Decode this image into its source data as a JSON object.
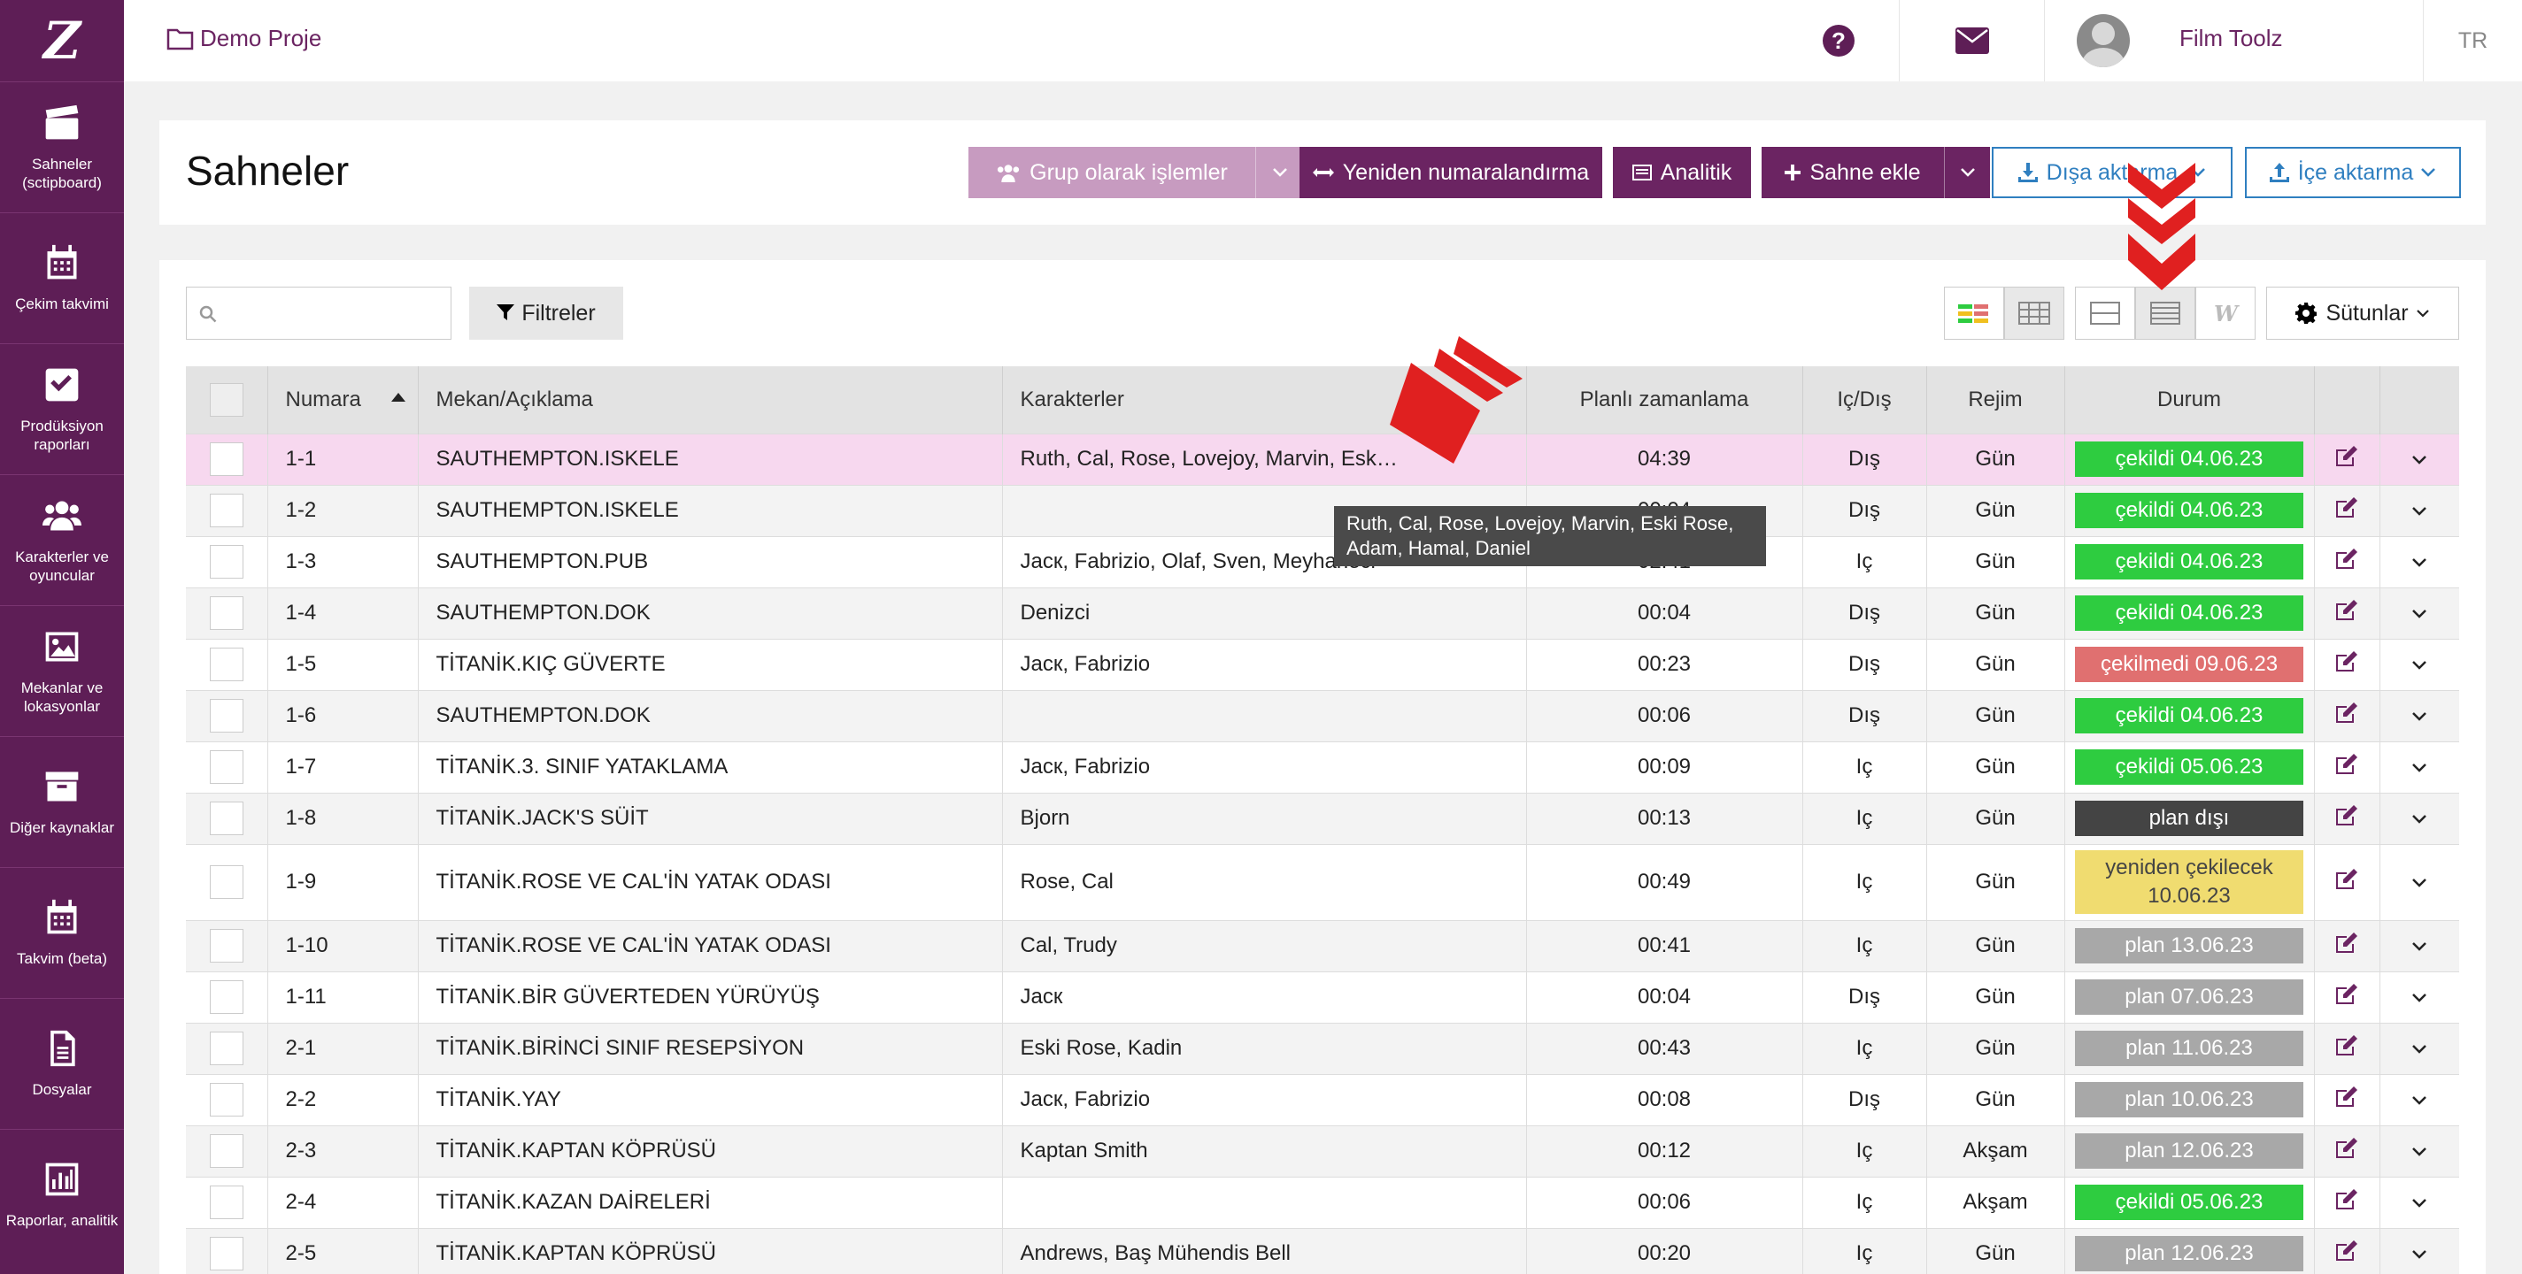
{
  "sidebar": {
    "logo": "Z",
    "items": [
      {
        "label": "Sahneler (sctipboard)",
        "icon": "clapperboard-icon"
      },
      {
        "label": "Çekim takvimi",
        "icon": "calendar-icon"
      },
      {
        "label": "Prodüksiyon raporları",
        "icon": "checkbox-icon"
      },
      {
        "label": "Karakterler ve oyuncular",
        "icon": "users-icon"
      },
      {
        "label": "Mekanlar ve lokasyonlar",
        "icon": "image-icon"
      },
      {
        "label": "Diğer kaynaklar",
        "icon": "archive-icon"
      },
      {
        "label": "Takvim (beta)",
        "icon": "calendar-icon"
      },
      {
        "label": "Dosyalar",
        "icon": "file-icon"
      },
      {
        "label": "Raporlar, analitik",
        "icon": "bar-chart-icon"
      }
    ]
  },
  "topbar": {
    "project": "Demo Proje",
    "username": "Film Toolz",
    "lang": "TR"
  },
  "header": {
    "title": "Sahneler",
    "group_ops": "Grup olarak işlemler",
    "renumber": "Yeniden numaralandırma",
    "analytics": "Analitik",
    "add_scene": "Sahne ekle",
    "export": "Dışa aktarma",
    "import": "İçe aktarma"
  },
  "toolbar": {
    "filters": "Filtreler",
    "columns": "Sütunlar"
  },
  "table": {
    "headers": {
      "number": "Numara",
      "location": "Mekan/Açıklama",
      "characters": "Karakterler",
      "planned": "Planlı zamanlama",
      "intext": "Iç/Dış",
      "regime": "Rejim",
      "status": "Durum"
    },
    "rows": [
      {
        "num": "1-1",
        "loc": "SAUTHEMPTON.ISKELE",
        "chars": "Ruth, Cal, Rose, Lovejoy, Marvin, Esk…",
        "time": "04:39",
        "ie": "Dış",
        "reg": "Gün",
        "status": "çekildi 04.06.23"
      },
      {
        "num": "1-2",
        "loc": "SAUTHEMPTON.ISKELE",
        "chars": "",
        "time": "00:04",
        "ie": "Dış",
        "reg": "Gün",
        "status": "çekildi 04.06.23"
      },
      {
        "num": "1-3",
        "loc": "SAUTHEMPTON.PUB",
        "chars": "Jacк, Fabrizio, Olaf, Sven, Meyhaneci",
        "time": "02:41",
        "ie": "Iç",
        "reg": "Gün",
        "status": "çekildi 04.06.23"
      },
      {
        "num": "1-4",
        "loc": "SAUTHEMPTON.DOK",
        "chars": "Denizci",
        "time": "00:04",
        "ie": "Dış",
        "reg": "Gün",
        "status": "çekildi 04.06.23"
      },
      {
        "num": "1-5",
        "loc": "TİTANİK.KIÇ GÜVERTE",
        "chars": "Jacк, Fabrizio",
        "time": "00:23",
        "ie": "Dış",
        "reg": "Gün",
        "status": "çekilmedi 09.06.23"
      },
      {
        "num": "1-6",
        "loc": "SAUTHEMPTON.DOK",
        "chars": "",
        "time": "00:06",
        "ie": "Dış",
        "reg": "Gün",
        "status": "çekildi 04.06.23"
      },
      {
        "num": "1-7",
        "loc": "TİTANİK.3. SINIF YATAKLAMA",
        "chars": "Jacк, Fabrizio",
        "time": "00:09",
        "ie": "Iç",
        "reg": "Gün",
        "status": "çekildi 05.06.23"
      },
      {
        "num": "1-8",
        "loc": "TİTANİK.JACK'S SÜİT",
        "chars": "Bjorn",
        "time": "00:13",
        "ie": "Iç",
        "reg": "Gün",
        "status": "plan dışı"
      },
      {
        "num": "1-9",
        "loc": "TİTANİK.ROSE VE CAL'İN YATAK ODASI",
        "chars": "Rose, Cal",
        "time": "00:49",
        "ie": "Iç",
        "reg": "Gün",
        "status": "yeniden çekilecek 10.06.23"
      },
      {
        "num": "1-10",
        "loc": "TİTANİK.ROSE VE CAL'İN YATAK ODASI",
        "chars": "Cal, Trudy",
        "time": "00:41",
        "ie": "Iç",
        "reg": "Gün",
        "status": "plan 13.06.23"
      },
      {
        "num": "1-11",
        "loc": "TİTANİK.BİR GÜVERTEDEN YÜRÜYÜŞ",
        "chars": "Jacк",
        "time": "00:04",
        "ie": "Dış",
        "reg": "Gün",
        "status": "plan 07.06.23"
      },
      {
        "num": "2-1",
        "loc": "TİTANİK.BİRİNCİ SINIF RESEPSİYON",
        "chars": "Eski Rose, Kadin",
        "time": "00:43",
        "ie": "Iç",
        "reg": "Gün",
        "status": "plan 11.06.23"
      },
      {
        "num": "2-2",
        "loc": "TİTANİK.YAY",
        "chars": "Jacк, Fabrizio",
        "time": "00:08",
        "ie": "Dış",
        "reg": "Gün",
        "status": "plan 10.06.23"
      },
      {
        "num": "2-3",
        "loc": "TİTANİK.KAPTAN KÖPRÜSÜ",
        "chars": "Kaptan Smith",
        "time": "00:12",
        "ie": "Iç",
        "reg": "Akşam",
        "status": "plan 12.06.23"
      },
      {
        "num": "2-4",
        "loc": "TİTANİK.KAZAN DAİRELERİ",
        "chars": "",
        "time": "00:06",
        "ie": "Iç",
        "reg": "Akşam",
        "status": "çekildi 05.06.23"
      },
      {
        "num": "2-5",
        "loc": "TİTANİK.KAPTAN KÖPRÜSÜ",
        "chars": "Andrews, Baş Mühendis Bell",
        "time": "00:20",
        "ie": "Iç",
        "reg": "Gün",
        "status": "plan 12.06.23"
      }
    ]
  },
  "tooltip": "Ruth, Cal, Rose, Lovejoy, Marvin, Eski Rose, Adam, Hamal, Daniel",
  "colors": {
    "sidebar": "#5e1e56",
    "accent": "#6b2462",
    "shot": "#2ecc40",
    "not_shot": "#e07070",
    "unplanned": "#444444",
    "reshoot": "#f0dc70",
    "planned": "#a8a8a8",
    "annotation_arrow": "#e02020"
  }
}
